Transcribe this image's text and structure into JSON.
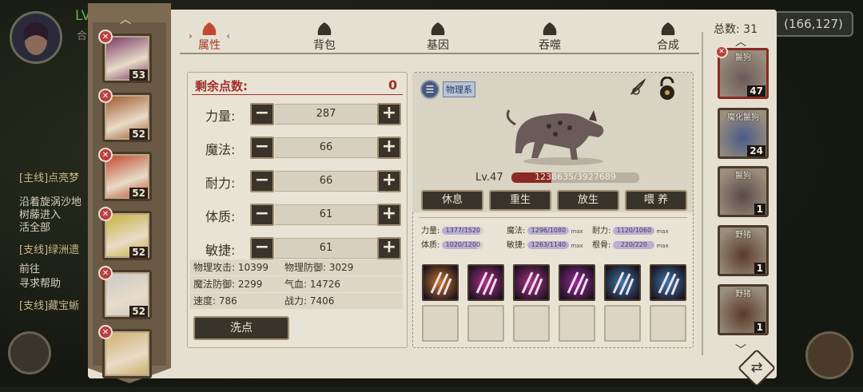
{
  "background": {
    "player_level_prefix": "LV",
    "player_sub": "合",
    "quest_lines": [
      {
        "text": "[主线]点亮梦",
        "kind": "q"
      },
      {
        "text": "沿着旋涡沙地",
        "kind": "n"
      },
      {
        "text": "树藤进入",
        "kind": "n"
      },
      {
        "text": "活全部",
        "kind": "n"
      },
      {
        "text": "[支线]绿洲遗",
        "kind": "q"
      },
      {
        "text": "前往",
        "kind": "n"
      },
      {
        "text": "寻求帮助",
        "kind": "n"
      },
      {
        "text": "[支线]藏宝蜥",
        "kind": "q"
      }
    ],
    "coord": "(166,127)"
  },
  "tabs": [
    {
      "label": "属性",
      "icon": "fire-icon",
      "active": true
    },
    {
      "label": "背包",
      "icon": "beast-head-icon",
      "active": false
    },
    {
      "label": "基因",
      "icon": "eye-icon",
      "active": false
    },
    {
      "label": "吞噬",
      "icon": "swirl-icon",
      "active": false
    },
    {
      "label": "合成",
      "icon": "spiral-icon",
      "active": false
    }
  ],
  "heroes": [
    {
      "level": "53"
    },
    {
      "level": "52"
    },
    {
      "level": "52"
    },
    {
      "level": "52"
    },
    {
      "level": "52"
    },
    {
      "level": ""
    }
  ],
  "stats": {
    "remain_label": "剩余点数:",
    "remain_value": "0",
    "rows": [
      {
        "label": "力量:",
        "value": "287"
      },
      {
        "label": "魔法:",
        "value": "66"
      },
      {
        "label": "耐力:",
        "value": "66"
      },
      {
        "label": "体质:",
        "value": "61"
      },
      {
        "label": "敏捷:",
        "value": "61"
      }
    ],
    "derived": [
      {
        "a": "物理攻击: 10399",
        "b": "物理防御: 3029"
      },
      {
        "a": "魔法防御: 2299",
        "b": "气血: 14726"
      },
      {
        "a": "速度: 786",
        "b": "战力: 7406"
      }
    ],
    "reset_label": "洗点"
  },
  "pet": {
    "tag": "物理系",
    "level": "Lv.47",
    "exp_text": "1238635/3927689",
    "exp_fraction": 0.315,
    "actions": [
      "休息",
      "重生",
      "放生",
      "喂 养"
    ],
    "aptitudes": [
      {
        "label": "力量:",
        "value": "1377/1520",
        "fill": 0.9,
        "max": ""
      },
      {
        "label": "魔法:",
        "value": "1296/1080",
        "fill": 1.0,
        "max": "max"
      },
      {
        "label": "耐力:",
        "value": "1120/1060",
        "fill": 1.0,
        "max": "max"
      },
      {
        "label": "体质:",
        "value": "1020/1200",
        "fill": 0.85,
        "max": ""
      },
      {
        "label": "敏捷:",
        "value": "1263/1140",
        "fill": 1.0,
        "max": "max"
      },
      {
        "label": "根骨:",
        "value": "220/220",
        "fill": 1.0,
        "max": "max"
      }
    ],
    "skills": [
      {
        "icon": "sun-rune-icon",
        "color": "#c47a28"
      },
      {
        "icon": "claw-slash-icon",
        "color": "#b0308a"
      },
      {
        "icon": "claw-slash-icon",
        "color": "#b0308a"
      },
      {
        "icon": "burst-icon",
        "color": "#9a2a9a"
      },
      {
        "icon": "ice-claw-icon",
        "color": "#3a7aa8"
      },
      {
        "icon": "ice-shard-icon",
        "color": "#3a7aa8"
      }
    ]
  },
  "pet_list": {
    "total_label": "总数: 31",
    "items": [
      {
        "name": "鬣狗",
        "level": "47",
        "selected": true
      },
      {
        "name": "魔化鬣狗",
        "level": "24",
        "selected": false
      },
      {
        "name": "鬣狗",
        "level": "1",
        "selected": false
      },
      {
        "name": "野猪",
        "level": "1",
        "selected": false
      },
      {
        "name": "野猪",
        "level": "1",
        "selected": false
      }
    ]
  },
  "colors": {
    "accent_red": "#a0302a",
    "panel": "#e6e0d2",
    "button": "#3a332a"
  }
}
